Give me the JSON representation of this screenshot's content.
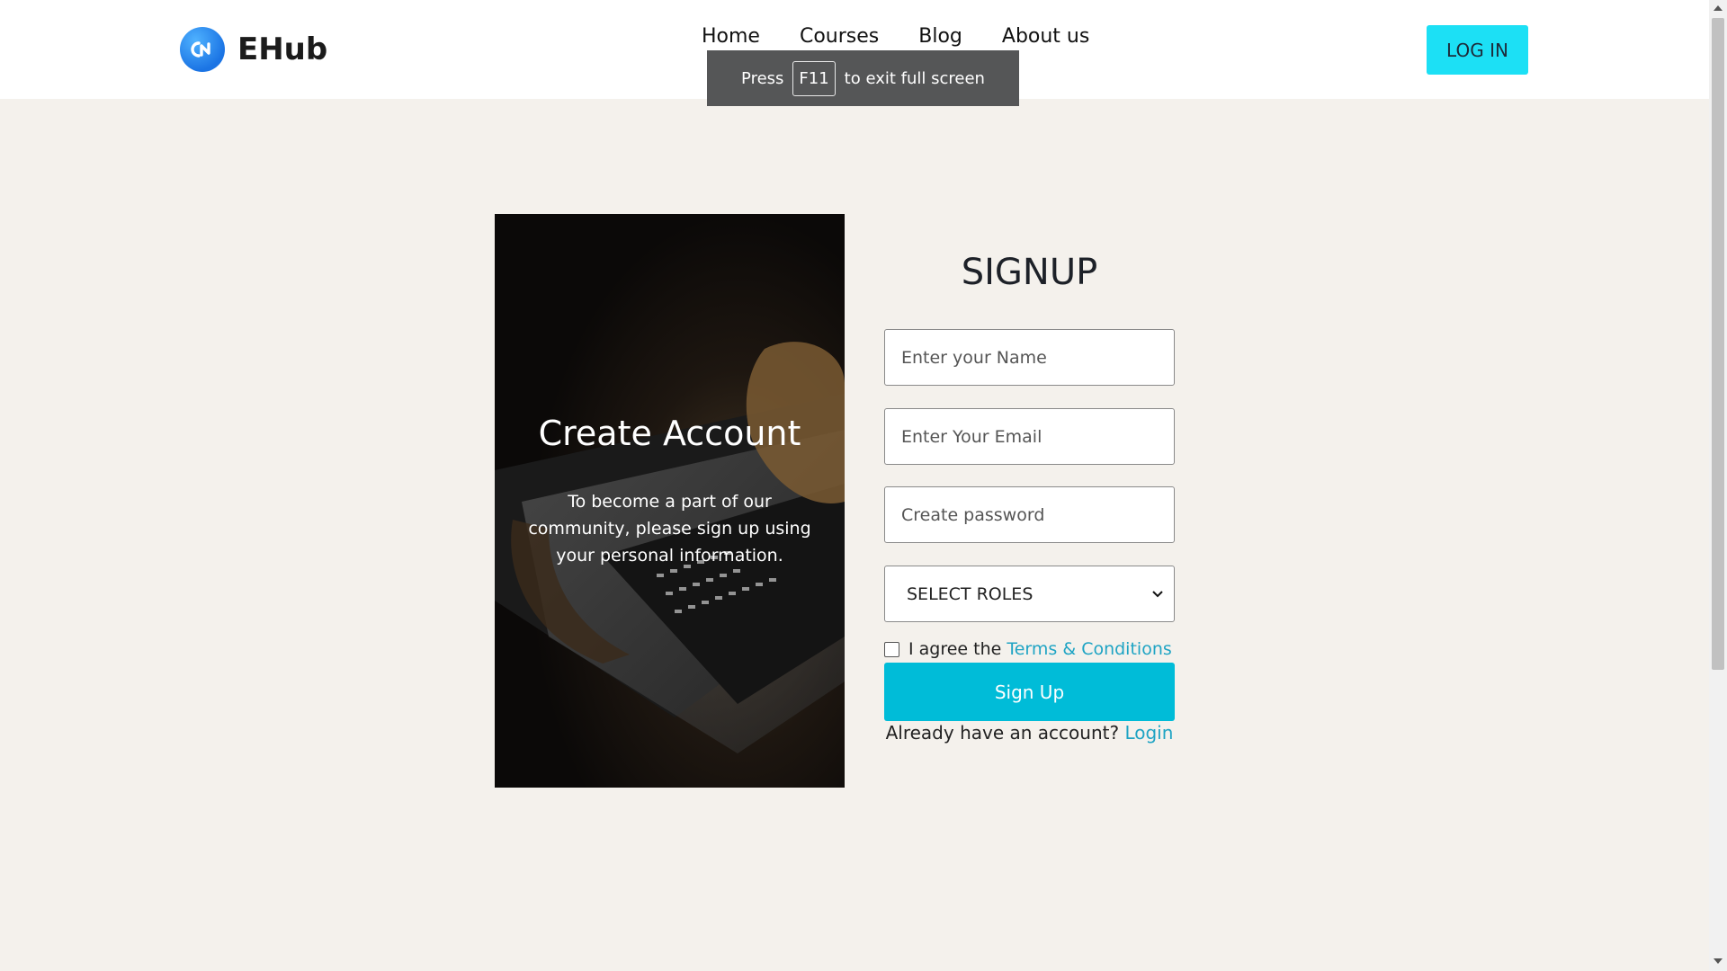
{
  "header": {
    "brand_name": "EHub",
    "nav": [
      "Home",
      "Courses",
      "Blog",
      "About us"
    ],
    "login_label": "LOG IN"
  },
  "fullscreen_toast": {
    "prefix": "Press",
    "key": "F11",
    "suffix": "to exit full screen"
  },
  "hero": {
    "title": "Create Account",
    "text": "To become a part of our community, please sign up using your personal information."
  },
  "signup": {
    "title": "SIGNUP",
    "name_placeholder": "Enter your Name",
    "email_placeholder": "Enter Your Email",
    "password_placeholder": "Create password",
    "role_selected": "SELECT ROLES",
    "agree_text": "I agree the",
    "terms_link": "Terms & Conditions",
    "button_label": "Sign Up",
    "account_prompt": "Already have an account?",
    "login_link": "Login"
  },
  "colors": {
    "accent": "#00bcd8",
    "login_button": "#1ce0f5",
    "link": "#1fa4c4",
    "page_background": "#f4f1ec"
  },
  "icons": {
    "logo": "ehub-logo-icon",
    "dropdown": "chevron-down-icon"
  }
}
